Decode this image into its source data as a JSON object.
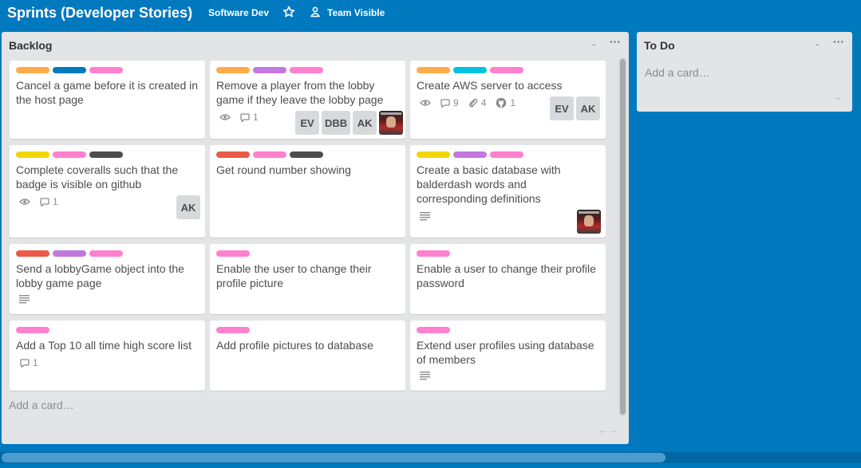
{
  "header": {
    "title": "Sprints (Developer Stories)",
    "org": "Software Dev",
    "visibility": "Team Visible"
  },
  "colors": {
    "orange": "#ffab4a",
    "blue": "#0079bf",
    "pink": "#ff80ce",
    "purple": "#c377e0",
    "sky": "#00c2e0",
    "yellow": "#f2d600",
    "black": "#4d4d4d",
    "red": "#eb5a46"
  },
  "lists": [
    {
      "title": "Backlog",
      "minimize": "-",
      "menu": "···",
      "add_card": "Add a card…",
      "arrows": "←→",
      "cards": [
        {
          "labels": [
            "orange",
            "blue",
            "pink"
          ],
          "title": "Cancel a game before it is created in the host page"
        },
        {
          "labels": [
            "orange",
            "purple",
            "pink"
          ],
          "title": "Remove a player from the lobby game if they leave the lobby page",
          "watch": "",
          "comments": "1",
          "members": [
            "EV",
            "DBB",
            "AK"
          ],
          "has_avatar": true
        },
        {
          "labels": [
            "orange",
            "sky",
            "pink"
          ],
          "title": "Create AWS server to access",
          "watch": "",
          "comments": "9",
          "attachments": "4",
          "github": "1",
          "members": [
            "EV",
            "AK"
          ]
        },
        {
          "labels": [
            "yellow",
            "pink",
            "black"
          ],
          "title": "Complete coveralls such that the badge is visible on github",
          "watch": "",
          "comments": "1",
          "members": [
            "AK"
          ]
        },
        {
          "labels": [
            "red",
            "pink",
            "black"
          ],
          "title": "Get round number showing"
        },
        {
          "labels": [
            "yellow",
            "purple",
            "pink"
          ],
          "title": "Create a basic database with balderdash words and corresponding definitions",
          "has_desc": true,
          "has_avatar": true
        },
        {
          "labels": [
            "red",
            "purple",
            "pink"
          ],
          "title": "Send a lobbyGame object into the lobby game page",
          "has_desc": true
        },
        {
          "labels": [
            "pink"
          ],
          "title": "Enable the user to change their profile picture"
        },
        {
          "labels": [
            "pink"
          ],
          "title": "Enable a user to change their profile password"
        },
        {
          "labels": [
            "pink"
          ],
          "title": "Add a Top 10 all time high score list",
          "comments": "1"
        },
        {
          "labels": [
            "pink"
          ],
          "title": "Add profile pictures to database"
        },
        {
          "labels": [
            "pink"
          ],
          "title": "Extend user profiles using database of members",
          "has_desc": true
        }
      ]
    },
    {
      "title": "To Do",
      "minimize": "-",
      "menu": "···",
      "add_card": "Add a card…",
      "arrows": "→"
    }
  ]
}
